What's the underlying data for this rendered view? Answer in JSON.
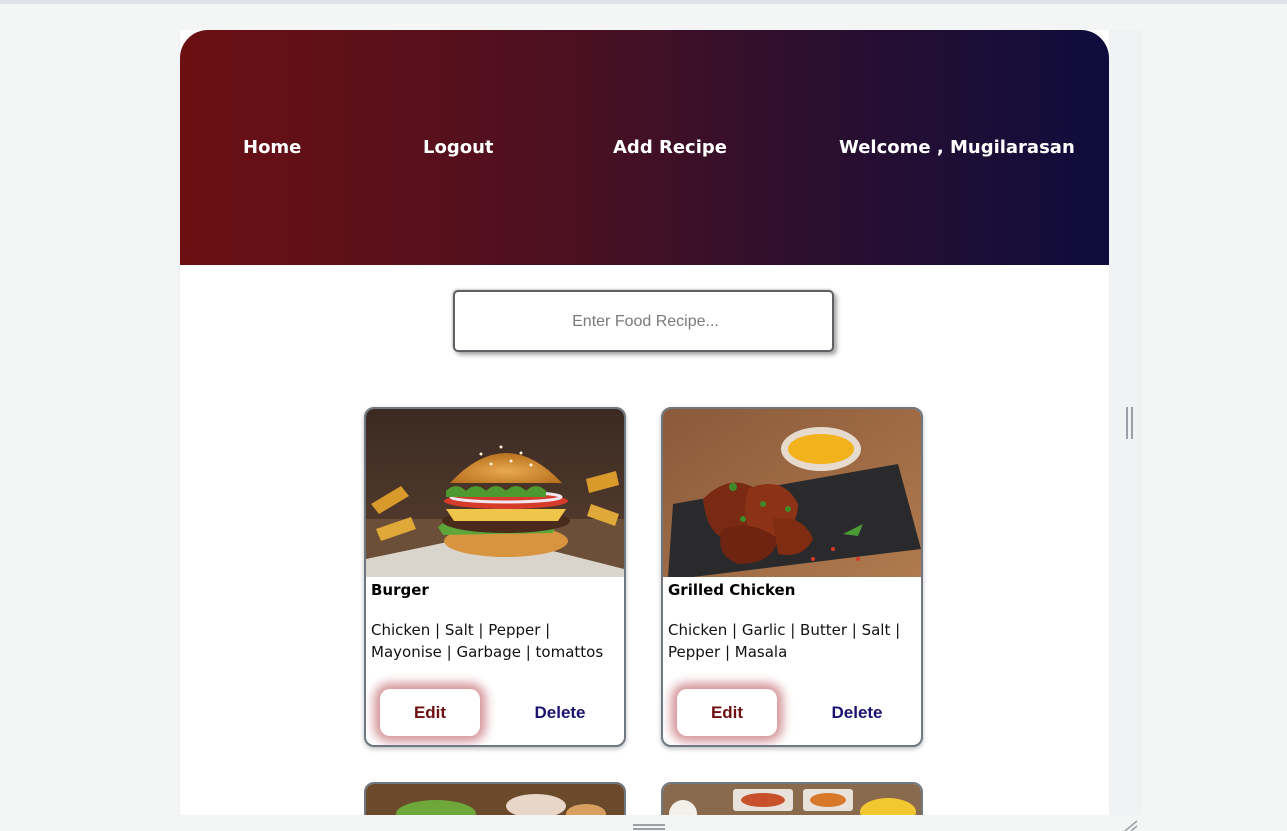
{
  "nav": {
    "home": "Home",
    "logout": "Logout",
    "add_recipe": "Add Recipe",
    "welcome": "Welcome , Mugilarasan"
  },
  "search": {
    "placeholder": "Enter Food Recipe..."
  },
  "recipes": [
    {
      "title": "Burger",
      "ingredients": "Chicken | Salt | Pepper | Mayonise | Garbage | tomattos",
      "edit_label": "Edit",
      "delete_label": "Delete"
    },
    {
      "title": "Grilled Chicken",
      "ingredients": "Chicken | Garlic | Butter | Salt | Pepper | Masala",
      "edit_label": "Edit",
      "delete_label": "Delete"
    }
  ],
  "colors": {
    "nav_gradient_start": "#6b1013",
    "nav_gradient_end": "#0f0c3c",
    "edit_text": "#6e0f12",
    "delete_text": "#1c1270"
  }
}
